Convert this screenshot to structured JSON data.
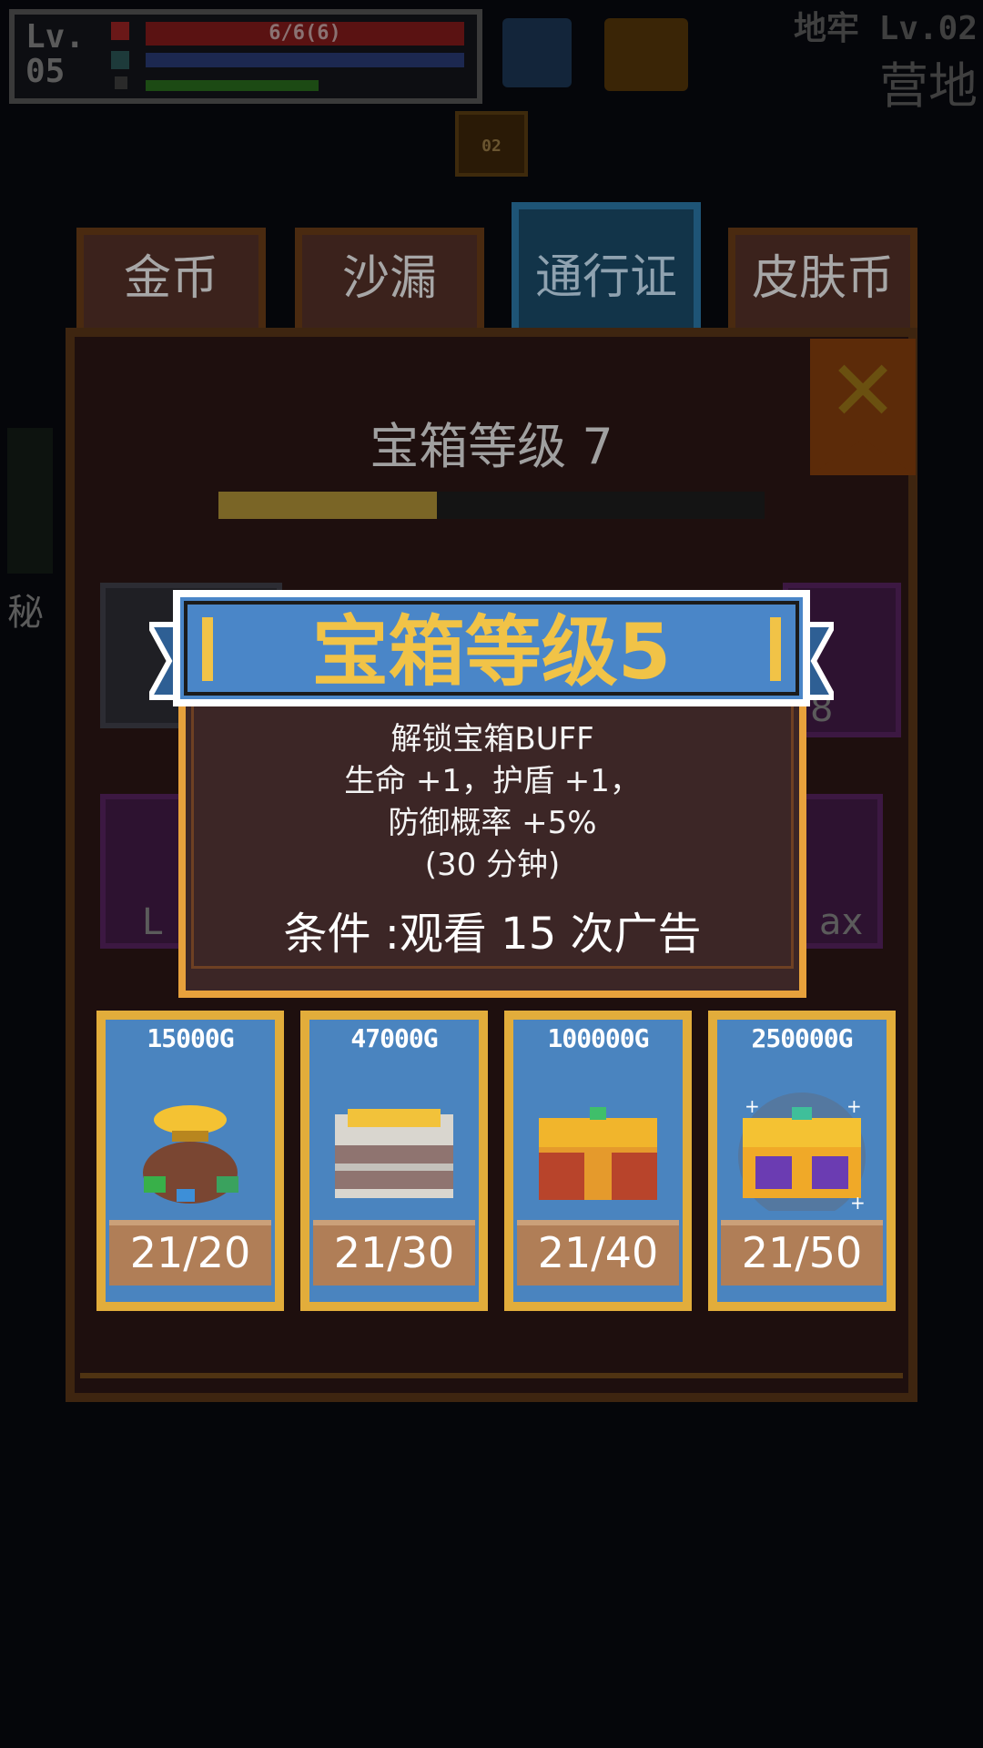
{
  "hud": {
    "level_label": "Lv.",
    "level_value": "05",
    "hp_text": "6/6(6)",
    "dungeon_label": "地牢 Lv.02",
    "location": "营地",
    "badge": "02"
  },
  "tabs": [
    {
      "label": "金币",
      "active": false
    },
    {
      "label": "沙漏",
      "active": false
    },
    {
      "label": "通行证",
      "active": true
    },
    {
      "label": "皮肤币",
      "active": false
    }
  ],
  "panel": {
    "chest_level_title": "宝箱等级 7",
    "progress": 0.4
  },
  "background_fragments": {
    "left_side": "秘",
    "slot_L": "L",
    "slot_8": "8",
    "slot_max": "ax"
  },
  "popup": {
    "title": "宝箱等级5",
    "desc_line1": "解锁宝箱BUFF",
    "desc_line2": "生命 +1，护盾 +1，",
    "desc_line3": "防御概率 +5%",
    "desc_line4": "(30 分钟)",
    "condition": "条件 :观看 15 次广告"
  },
  "chests": [
    {
      "price": "15000G",
      "count": "21/20",
      "icon": "gold-pot-icon"
    },
    {
      "price": "47000G",
      "count": "21/30",
      "icon": "silver-chest-icon"
    },
    {
      "price": "100000G",
      "count": "21/40",
      "icon": "red-chest-icon"
    },
    {
      "price": "250000G",
      "count": "21/50",
      "icon": "purple-chest-icon"
    }
  ],
  "colors": {
    "card_frame": "#e2ad3b",
    "card_bg": "#4a84bf",
    "ribbon_blue": "#4a86c8",
    "popup_bg": "#3c2626",
    "popup_title": "#f1c347"
  }
}
